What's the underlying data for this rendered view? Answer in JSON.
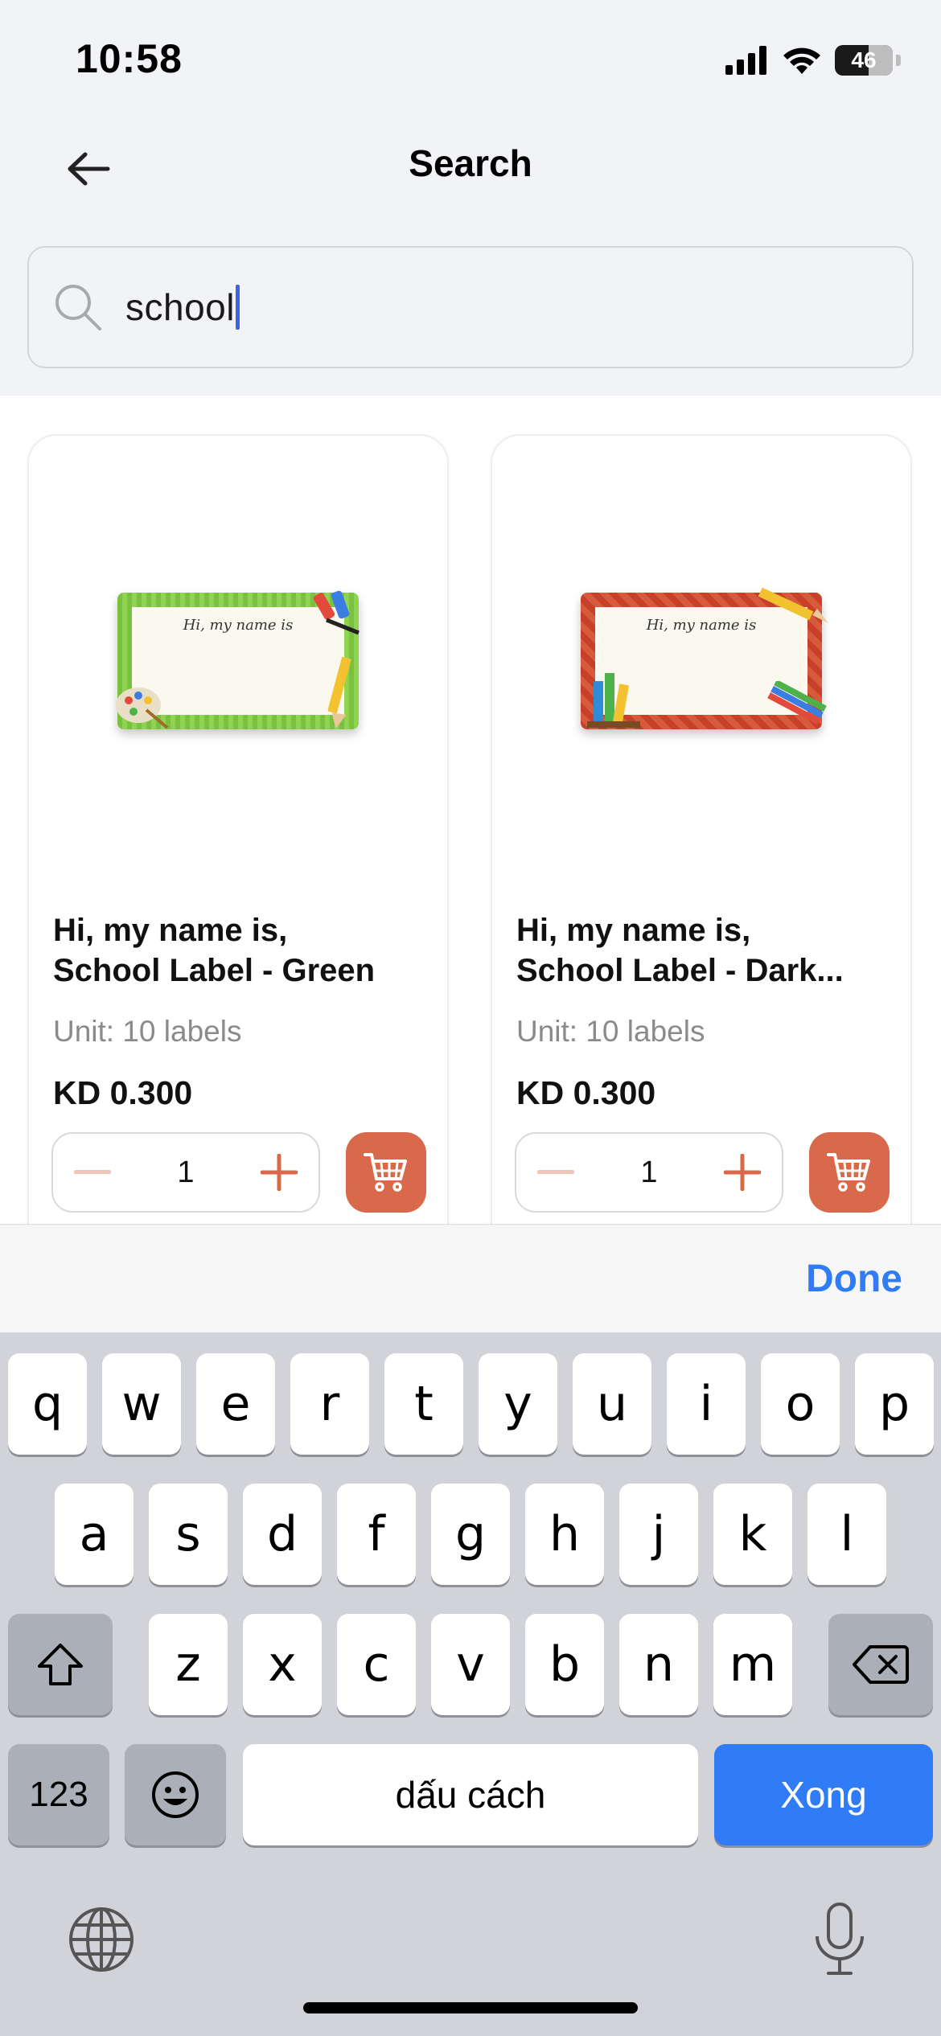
{
  "status_bar": {
    "time": "10:58",
    "battery": "46"
  },
  "header": {
    "title": "Search",
    "back_icon": "arrow-left-icon"
  },
  "search": {
    "value": "school",
    "icon": "search-icon"
  },
  "products": [
    {
      "name_line1": "Hi, my name is,",
      "name_line2": "School Label - Green",
      "label_script": "Hi, my name is",
      "unit": "Unit: 10 labels",
      "price": "KD 0.300",
      "quantity": "1",
      "accent": "#79c13f"
    },
    {
      "name_line1": "Hi, my name is,",
      "name_line2": "School Label - Dark...",
      "label_script": "Hi, my name is",
      "unit": "Unit: 10 labels",
      "price": "KD 0.300",
      "quantity": "1",
      "accent": "#c8402a"
    }
  ],
  "colors": {
    "cart_button": "#d9694b",
    "done": "#2f7cf6",
    "stepper_plus": "#d9694b",
    "stepper_minus": "#f0c4b6"
  },
  "accessory": {
    "done_label": "Done"
  },
  "keyboard": {
    "row1": [
      "q",
      "w",
      "e",
      "r",
      "t",
      "y",
      "u",
      "i",
      "o",
      "p"
    ],
    "row2": [
      "a",
      "s",
      "d",
      "f",
      "g",
      "h",
      "j",
      "k",
      "l"
    ],
    "row3": [
      "z",
      "x",
      "c",
      "v",
      "b",
      "n",
      "m"
    ],
    "numbers_label": "123",
    "space_label": "dấu cách",
    "return_label": "Xong"
  }
}
